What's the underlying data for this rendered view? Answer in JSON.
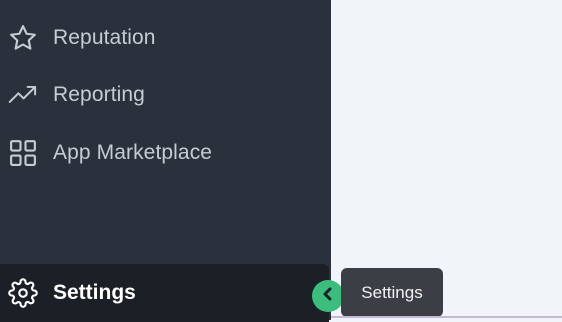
{
  "sidebar": {
    "items": [
      {
        "label": "Reputation",
        "icon": "star-icon"
      },
      {
        "label": "Reporting",
        "icon": "trending-up-icon"
      },
      {
        "label": "App Marketplace",
        "icon": "grid-icon"
      }
    ],
    "settings": {
      "label": "Settings",
      "icon": "gear-icon"
    }
  },
  "tooltip": {
    "text": "Settings"
  },
  "colors": {
    "sidebar_bg": "#2a313c",
    "active_bg": "#1b1f26",
    "accent": "#3dbd7d",
    "content_bg": "#f1f4f8"
  }
}
